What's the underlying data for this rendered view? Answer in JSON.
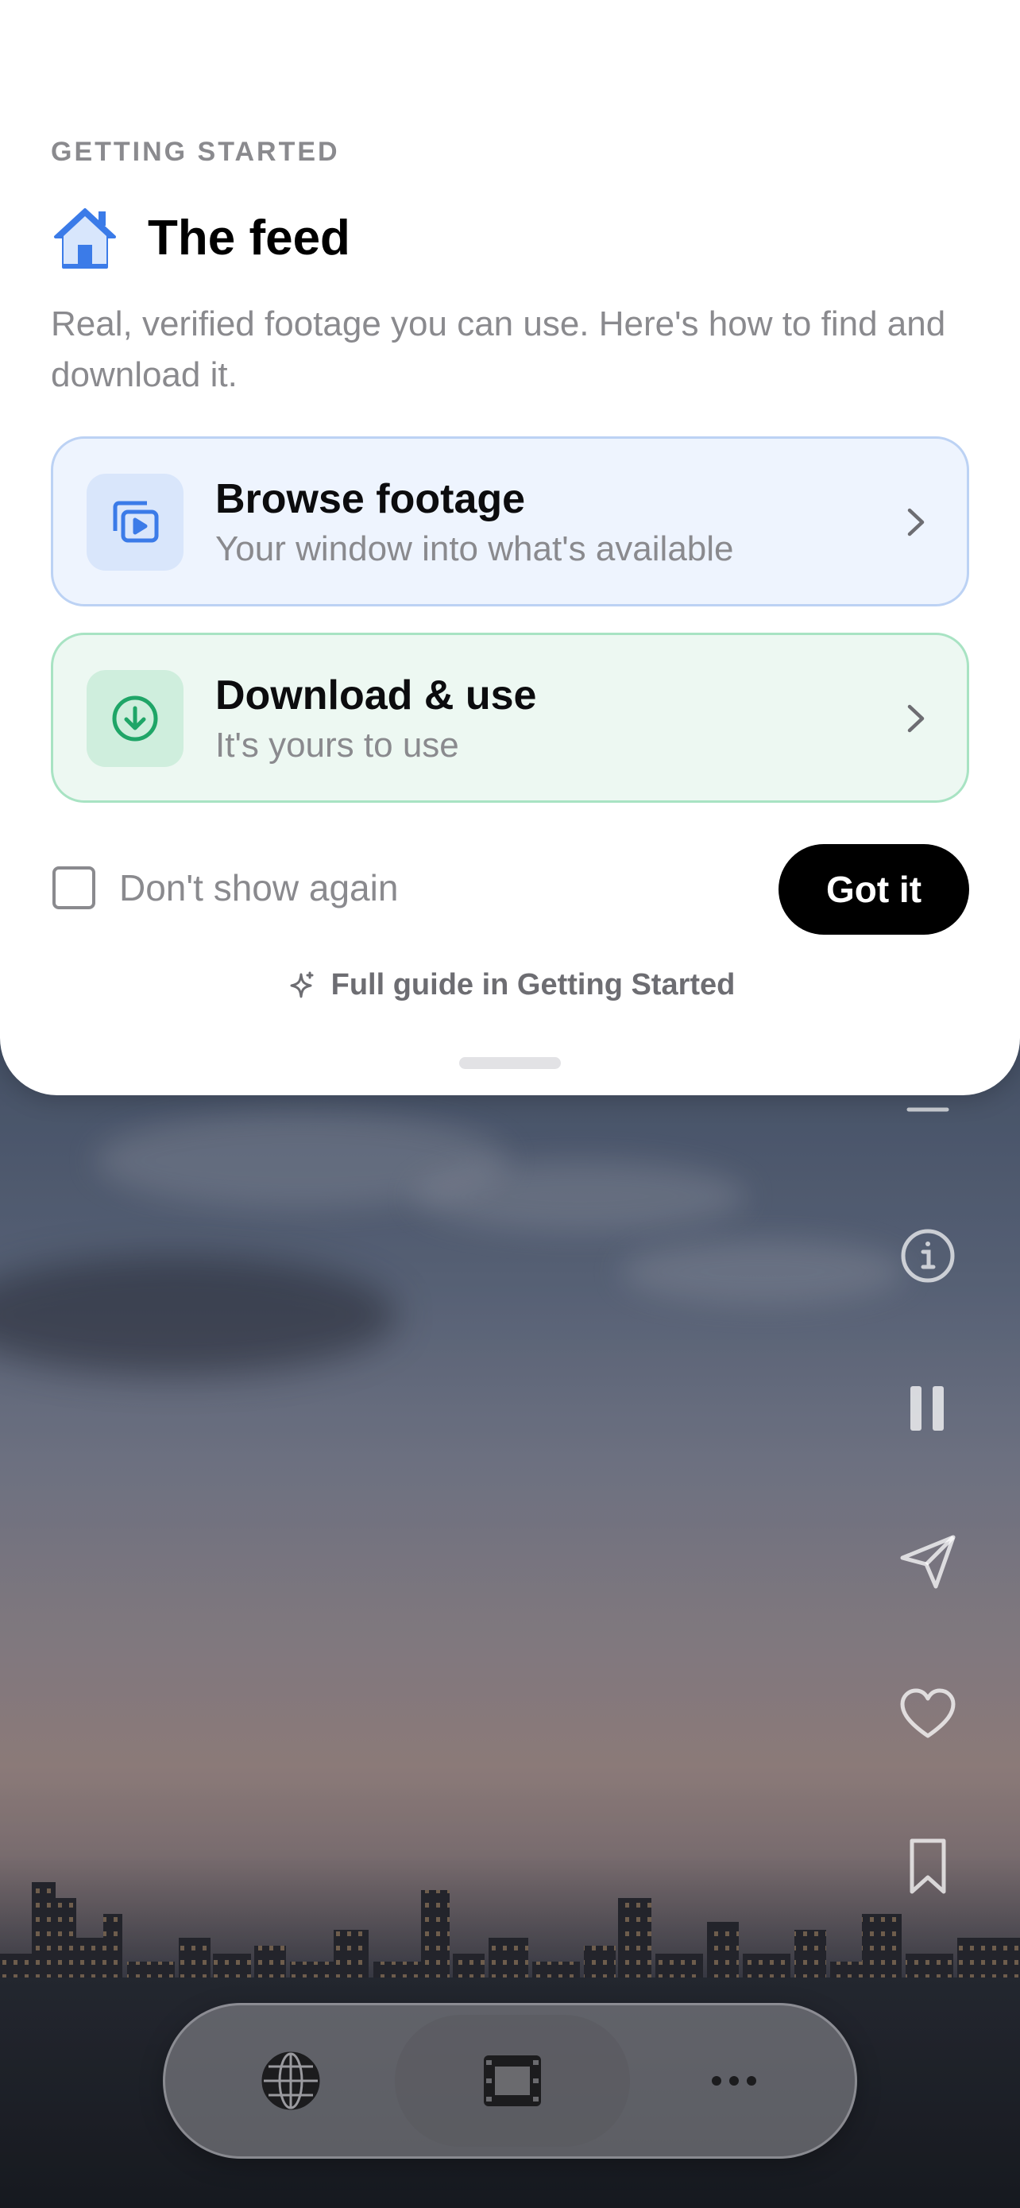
{
  "modal": {
    "eyebrow": "GETTING STARTED",
    "title": "The feed",
    "title_icon": "house-icon",
    "intro": "Real, verified footage you can use. Here's how to find and download it.",
    "cards": [
      {
        "title": "Browse footage",
        "subtitle": "Your window into what's available",
        "icon": "play-stack-icon",
        "accent": "#3b7be8"
      },
      {
        "title": "Download & use",
        "subtitle": "It's yours to use",
        "icon": "download-circle-icon",
        "accent": "#1fa567"
      }
    ],
    "dont_show_label": "Don't show again",
    "dont_show_checked": false,
    "confirm_label": "Got it",
    "guide_link": "Full guide in Getting Started",
    "guide_icon": "sparkle-icon"
  },
  "rail": {
    "icons": [
      "menu-icon",
      "info-icon",
      "pause-icon",
      "share-icon",
      "heart-icon",
      "bookmark-icon"
    ]
  },
  "tabbar": {
    "tabs": [
      {
        "icon": "globe-icon",
        "active": false
      },
      {
        "icon": "film-icon",
        "active": true
      },
      {
        "icon": "more-icon",
        "active": false
      }
    ]
  },
  "colors": {
    "browse_bg": "#eef4fe",
    "download_bg": "#edf8f2",
    "button_bg": "#000000"
  }
}
